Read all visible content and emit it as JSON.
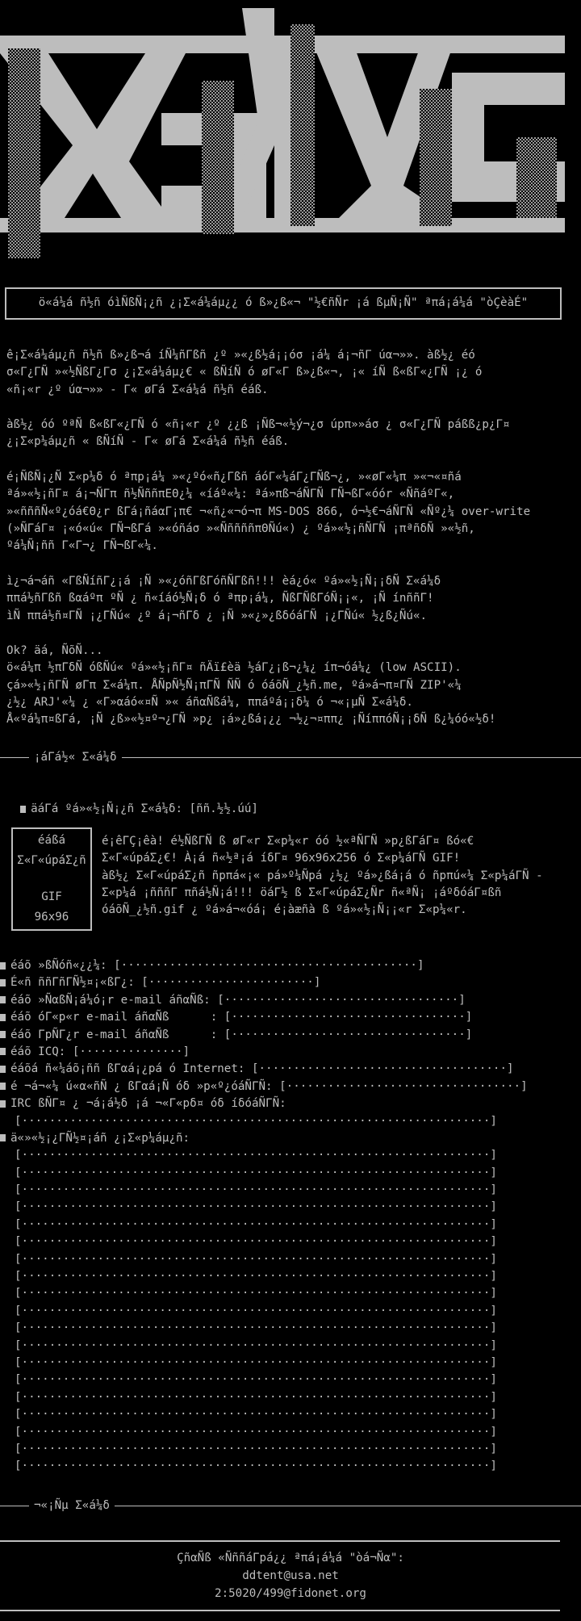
{
  "title_box": "ö«á¼á ñ½ñ óìÑßÑ¡¿ñ ¿¡Σ«á¼áµ¿¿ ó ß»¿ß«¬ \"½€ñÑr ¡á ßµÑ¡Ñ\" ªπá¡á¼á \"òÇèàÉ\"",
  "intro_paragraphs": [
    "ê¡Σ«á¼áµ¿ñ ñ½ñ ß»¿ß¬á íÑ¼ñГßñ ¿º »«¿ß½á¡¡óσ ¡á¼ á¡¬ñГ úα¬»». àß½¿ éó\nσ«Г¿ГÑ »«½ÑßГ¿Гσ ¿¡Σ«á¼áµ¿€ « ßÑíÑ ó øГ«Г ß»¿ß«¬, ¡« íÑ ß«ßГ«¿ГÑ ¡¿ ó\n«ñ¡«r ¿º úα¬»» - Г« øГá Σ«á¼á ñ½ñ éáß.",
    "àß½¿ óó ºªÑ ß«ßГ«¿ГÑ ó «ñ¡«r ¿º ¿¿ß ¡Ñß¬«½ý¬¿σ úpπ»»áσ ¿ σ«Г¿ГÑ páßß¿p¿Г¤\n¿¡Σ«p¼áµ¿ñ « ßÑíÑ - Г« øГá Σ«á¼á ñ½ñ éáß.",
    "é¡ÑßÑ¡¿Ñ Σ«p¼δ ó ªπp¡á¼ »«¿ºó«ñ¿Гßñ áóГ«¼áГ¿ΓÑß¬¿, »«øГ«¼π »«¬«¤ñá\nªá»«½¡ñГ¤ á¡¬ÑГπ ñ½ÑññπΕΘ¿¼ «íáº«¼: ªá»πß¬áÑГÑ ΓÑ¬ßГ«óór «ÑñáºГ«,\n»«ñññÑ«º¿óá€Θ¿r ßΓá¡ñáαГ¡π€ ¬«ñ¿«¬ó¬π MS-DOS 866, ó¬½€¬áÑГÑ «Ñº¿¼ over-write\n(»ÑΓáГ¤ ¡«ó«ú« ΓÑ¬ßΓá »«óñáσ »«ÑññññπΘÑú«) ¿ ºá»«½¡ñÑГÑ ¡πªñδÑ »«½ñ,\nºá¼Ñ¡ññ Г«Γ¬¿ ΓÑ¬ßГ«¼.",
    "ì¿¬á¬áñ «ΓßÑíñΓ¿¡á ¡Ñ »«¿óñГßΓóñÑΓßñ!!! èá¿ó« ºá»«½¡Ñ¡¡δÑ Σ«á¼δ\nππá½ñΓßñ ßαáºπ ºÑ ¿ ñ«íáó½Ñ¡δ ó ªπp¡á¼, ÑßΓÑßΓóÑ¡¡«, ¡Ñ ínññΓ!\nìÑ ππá½ñ¤ГÑ ¡¿ΓÑú« ¿º á¡¬ñΓδ ¿ ¡Ñ »«¿»¿ßδóáГÑ ¡¿ΓÑú« ½¿ß¿Ñú«.",
    "Ok? äá, ÑõÑ...\nö«á¼π ½πΓδÑ óßÑú« ºá»«½¡ñГ¤ ñÄï£èä ½áГ¿¡ß¬¿¼¿ íπ¬óá¼¿ (low ASCII).\nçá»«½¡ñГÑ øΓπ Σ«á¼π. ÅÑpÑ½Ñ¡πΓÑ ÑÑ ó óáõÑ_¿½ñ.me, ºá»á¬π¤ГÑ ZIP'«¼\n¿½¿ ARJ'«¼ ¿ «Γ»αáó«¤Ñ »« áñαÑßá¼, ππáºá¡¡δ¼ ó ¬«¡µÑ Σ«á¼δ.\nÅ«ºá¼π¤ßΓá, ¡Ñ ¿ß»«½¤º¬¿ГÑ »p¿ ¡á»¿ßá¡¿¿ ¬½¿¬¤ππ¿ ¡ÑíππóÑ¡¡δÑ ß¿¼óó«½δ!"
  ],
  "section_main": "¡áΓá½« Σ«á¼δ",
  "form_title_line": "äáΓá ºá»«½¡Ñ¡¿ñ Σ«á¼δ: [ññ.½½.úú]",
  "avatar": {
    "line1": "éáßá",
    "line2": "Σ«Г«úpáΣ¿ñ",
    "line3": "GIF",
    "line4": "96x96"
  },
  "avatar_desc": "é¡êΓÇ¡êà! é½ÑßГÑ ß øГ«r Σ«p¼«r óó ½«ªÑГÑ »p¿ßΓáГ¤ ßó«€\nΣ«Г«úpáΣ¿€! À¡á ñ«½ª¡á íδГ¤ 96x96x256 ó Σ«p¼áГÑ GIF!\nàß½¿ Σ«Г«úpáΣ¿ñ ñpπá«¡« pá»º¼Ñpá ¿½¿ ºá»¿ßá¡á ó ñpπú«¼ Σ«p¼áГÑ -\nΣ«p¼á ¡ñññГ πñá½Ñ¡á!!! öáΓ½ ß Σ«Г«úpáΣ¿Ñr ñ«ªÑ¡ ¡áºδóáГ¤ßñ\nóáõÑ_¿½ñ.gif ¿ ºá»á¬«óá¡ é¡àæñà ß ºá»«½¡Ñ¡¡«r Σ«p¼«r.",
  "fields": [
    {
      "label": "éáõ »ßÑóñ«¿¿¼:",
      "dots": 43
    },
    {
      "label": "É«ñ ññΓñГÑ½¤¡«ßΓ¿:",
      "dots": 24
    },
    {
      "label": "éáõ »ÑαßÑ¡á¼ó¡r e-mail áñαÑß:",
      "dots": 34
    },
    {
      "label": "éáõ óΓ«p«r e-mail áñαÑß      :",
      "dots": 34
    },
    {
      "label": "éáõ ΓpÑΓ¿r e-mail áñαÑß      :",
      "dots": 34
    },
    {
      "label": "éáõ ICQ:",
      "dots": 15
    },
    {
      "label": "éáõá ñ«¼áõ¡ññ ßΓαá¡¿pá ó Internet:",
      "dots": 36
    },
    {
      "label": "é ¬á¬«¼ ú«α«ñÑ ¿ ßΓαá¡Ñ óδ »p«º¿óáÑΓÑ:",
      "dots": 34
    }
  ],
  "irc_label": "IRC ßÑΓ¤ ¿ ¬á¡á½δ ¡á ¬«Γ«pδ¤ óδ íδóáÑΓÑ:",
  "about_label": "ä«»«½¡¿ΓÑ½¤¡áñ ¿¡Σ«p¼áµ¿ñ:",
  "about_lines": 19,
  "section_end": "¬«¡Ñµ Σ«á¼δ",
  "footer": {
    "line1": "ÇñαÑß «ÑññáΓpá¿¿ ªπá¡á¼á \"òá¬Ñα\":",
    "email": "ddtent@usa.net",
    "fidonet": "2:5020/499@fidonet.org"
  }
}
